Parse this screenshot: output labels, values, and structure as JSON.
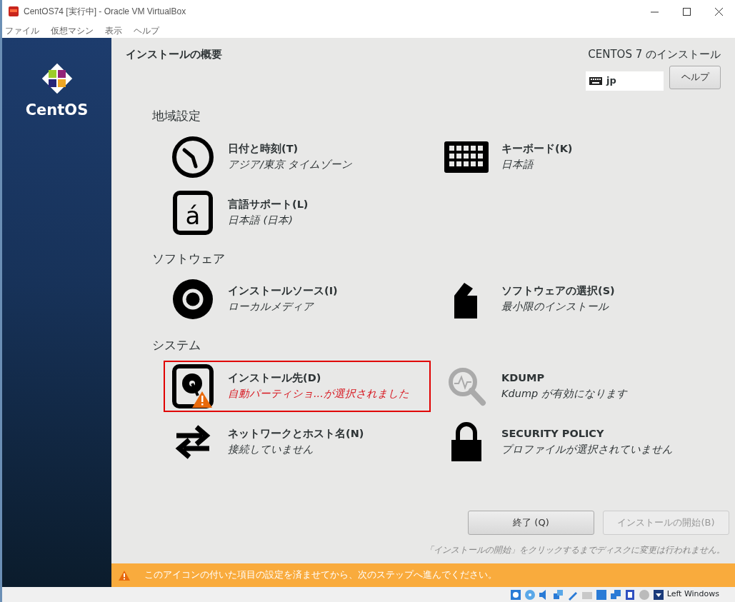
{
  "window": {
    "title": "CentOS74 [実行中] - Oracle VM VirtualBox"
  },
  "menu": [
    "ファイル",
    "仮想マシン",
    "表示",
    "ヘルプ"
  ],
  "sidebar": {
    "logo_text": "CentOS"
  },
  "header": {
    "title": "インストールの概要",
    "product": "CENTOS 7 のインストール",
    "keyboard_layout": "jp",
    "help_button": "ヘルプ"
  },
  "sections": [
    {
      "title": "地域設定",
      "spokes": [
        {
          "kind": "clock",
          "title": "日付と時刻(T)",
          "status": "アジア/東京 タイムゾーン",
          "warning": false,
          "icon_dimmed": false
        },
        {
          "kind": "keyboard",
          "title": "キーボード(K)",
          "status": "日本語",
          "warning": false,
          "icon_dimmed": false
        },
        {
          "kind": "language",
          "icon_text": "á",
          "title": "言語サポート(L)",
          "status": "日本語 (日本)",
          "warning": false,
          "icon_dimmed": false
        }
      ]
    },
    {
      "title": "ソフトウェア",
      "spokes": [
        {
          "kind": "disc",
          "title": "インストールソース(I)",
          "status": "ローカルメディア",
          "warning": false,
          "icon_dimmed": false
        },
        {
          "kind": "package",
          "title": "ソフトウェアの選択(S)",
          "status": "最小限のインストール",
          "warning": false,
          "icon_dimmed": false
        }
      ]
    },
    {
      "title": "システム",
      "spokes": [
        {
          "kind": "disk",
          "title": "インストール先(D)",
          "status": "自動パーティショ...が選択されました",
          "warning": true,
          "icon_dimmed": false
        },
        {
          "kind": "magnifier",
          "title": "KDUMP",
          "status": "Kdump が有効になります",
          "warning": false,
          "icon_dimmed": true
        },
        {
          "kind": "network",
          "title": "ネットワークとホスト名(N)",
          "status": "接続していません",
          "warning": false,
          "icon_dimmed": false
        },
        {
          "kind": "lock",
          "title": "SECURITY POLICY",
          "status": "プロファイルが選択されていません",
          "warning": false,
          "icon_dimmed": false
        }
      ]
    }
  ],
  "buttons": [
    {
      "label": "終了 (Q)",
      "disabled": false
    },
    {
      "label": "インストールの開始(B)",
      "disabled": true
    }
  ],
  "note": "「インストールの開始」をクリックするまでディスクに変更は行われません。",
  "warning_bar": {
    "text": "このアイコンの付いた項目の設定を済ませてから、次のステップへ進んでください。"
  },
  "status_bar": {
    "host_key": "Left Windows"
  }
}
